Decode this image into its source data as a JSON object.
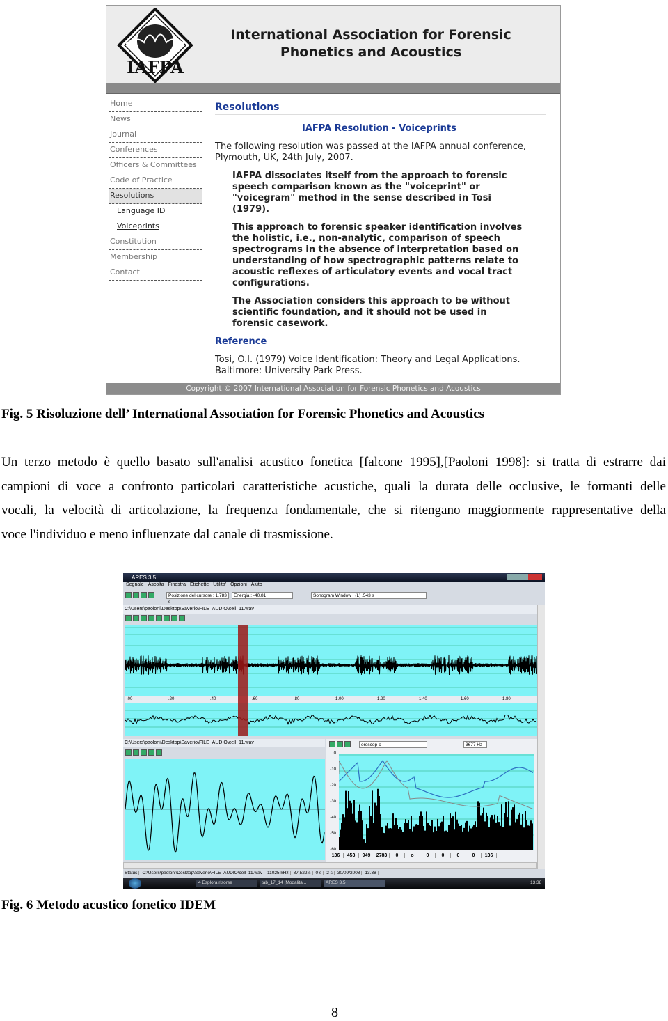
{
  "figure5": {
    "logo_text": "IAFPA",
    "site_title": "International Association for Forensic Phonetics and Acoustics",
    "sidebar": [
      {
        "label": "Home"
      },
      {
        "label": "News"
      },
      {
        "label": "Journal"
      },
      {
        "label": "Conferences"
      },
      {
        "label": "Officers & Committees"
      },
      {
        "label": "Code of Practice"
      },
      {
        "label": "Resolutions",
        "selected": true
      },
      {
        "label": "Language ID",
        "sub": true
      },
      {
        "label": "Voiceprints",
        "sub": true,
        "link": true
      },
      {
        "label": "Constitution"
      },
      {
        "label": "Membership"
      },
      {
        "label": "Contact"
      }
    ],
    "heading": "Resolutions",
    "subheading": "IAFPA Resolution - Voiceprints",
    "intro": "The following resolution was passed at the IAFPA annual conference, Plymouth, UK, 24th July, 2007.",
    "paragraphs": [
      "IAFPA dissociates itself from the approach to forensic speech comparison known as the \"voiceprint\" or \"voicegram\" method in the sense described in Tosi (1979).",
      "This approach to forensic speaker identification involves the holistic, i.e., non-analytic, comparison of speech spectrograms in the absence of interpretation based on understanding of how spectrographic patterns relate to acoustic reflexes of articulatory events and vocal tract configurations.",
      "The Association considers this approach to be without scientific foundation, and it should not be used in forensic casework."
    ],
    "reference_heading": "Reference",
    "reference": "Tosi, O.I. (1979) Voice Identification: Theory and Legal Applications. Baltimore: University Park Press.",
    "footer": "Copyright © 2007 International Association for Forensic Phonetics and Acoustics",
    "accent": "#1a3a96"
  },
  "caption5": "Fig. 5  Risoluzione dell’ International Association for Forensic Phonetics and Acoustics",
  "body_lines": [
    "Un terzo metodo  è quello basato  sull'analisi acustico fonetica [falcone 1995],[Paoloni 1998]: si tratta di estrarre dai",
    "campioni di voce a confronto particolari caratteristiche acustiche, quali la durata delle occlusive, le formanti delle",
    "vocali, la velocità di articolazione, la frequenza fondamentale, che si ritengano maggiormente rappresentative della",
    "voce l'individuo e meno influenzate dal canale di trasmissione."
  ],
  "figure6": {
    "app_title": "ARES 3.5",
    "menu": [
      "Segnale",
      "Ascolta",
      "Finestra",
      "Etichette",
      "Utilita'",
      "Opzioni",
      "Aiuto"
    ],
    "cursor_pos": "Posizione del cursore : 1.783 s",
    "energy": "Energia : -40.81",
    "sonogram": "Sonogram Window : (L) .543 s",
    "file_path": "C:\\Users\\paoloni\\Desktop\\Saverio\\FILE_AUDIO\\cell_11.wav",
    "time_ticks": [
      ".00",
      ".20",
      ".40",
      ".60",
      ".80",
      "1.00",
      "1.20",
      "1.40",
      "1.60",
      "1.80"
    ],
    "spectrum_field": "oroscop-o",
    "frequency": "3677 Hz",
    "db_ticks": [
      "0",
      "-10",
      "-20",
      "-30",
      "-40",
      "-50",
      "-60"
    ],
    "formant_values": [
      "136",
      "453",
      "949",
      "2783",
      "0",
      "o",
      "0",
      "0",
      "0",
      "0",
      "136"
    ],
    "status": [
      "Status",
      "C:\\Users\\paoloni\\Desktop\\Saverio\\FILE_AUDIO\\cell_11.wav",
      "11025 kHz",
      "87,522 s",
      "0 s",
      "2 s",
      "30/09/2008",
      "13.38"
    ],
    "taskbar": [
      "4 Esplora risorse",
      "tab_17_14 [Modalità...",
      "ARES 3.5"
    ],
    "clock": "13.38",
    "waveform_color": "#7ff3f7"
  },
  "caption6": "Fig. 6  Metodo acustico fonetico IDEM",
  "page_number": "8"
}
